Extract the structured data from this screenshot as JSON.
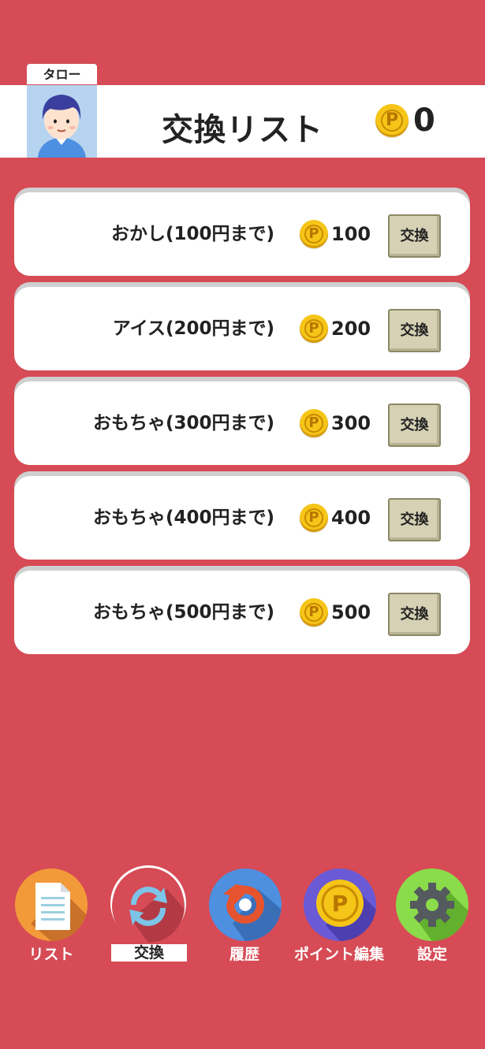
{
  "header": {
    "user_name": "タロー",
    "title": "交換リスト",
    "points": "0",
    "coin_letter": "P"
  },
  "rewards": [
    {
      "name": "おかし(100円まで)",
      "cost": "100",
      "button": "交換"
    },
    {
      "name": "アイス(200円まで)",
      "cost": "200",
      "button": "交換"
    },
    {
      "name": "おもちゃ(300円まで)",
      "cost": "300",
      "button": "交換"
    },
    {
      "name": "おもちゃ(400円まで)",
      "cost": "400",
      "button": "交換"
    },
    {
      "name": "おもちゃ(500円まで)",
      "cost": "500",
      "button": "交換"
    }
  ],
  "tabs": [
    {
      "label": "リスト",
      "icon": "document-icon",
      "color": "#f29a3a"
    },
    {
      "label": "交換",
      "icon": "exchange-arrows-icon",
      "color": "#d64b55",
      "active": true
    },
    {
      "label": "履歴",
      "icon": "history-arrow-icon",
      "color": "#4e8fe0"
    },
    {
      "label": "ポイント編集",
      "icon": "coin-icon",
      "color": "#6a5ad6"
    },
    {
      "label": "設定",
      "icon": "gear-icon",
      "color": "#8bdc4a"
    }
  ],
  "colors": {
    "background": "#d64b55",
    "card": "#ffffff",
    "button": "#d6d1b4",
    "coin": "#f5c518"
  }
}
